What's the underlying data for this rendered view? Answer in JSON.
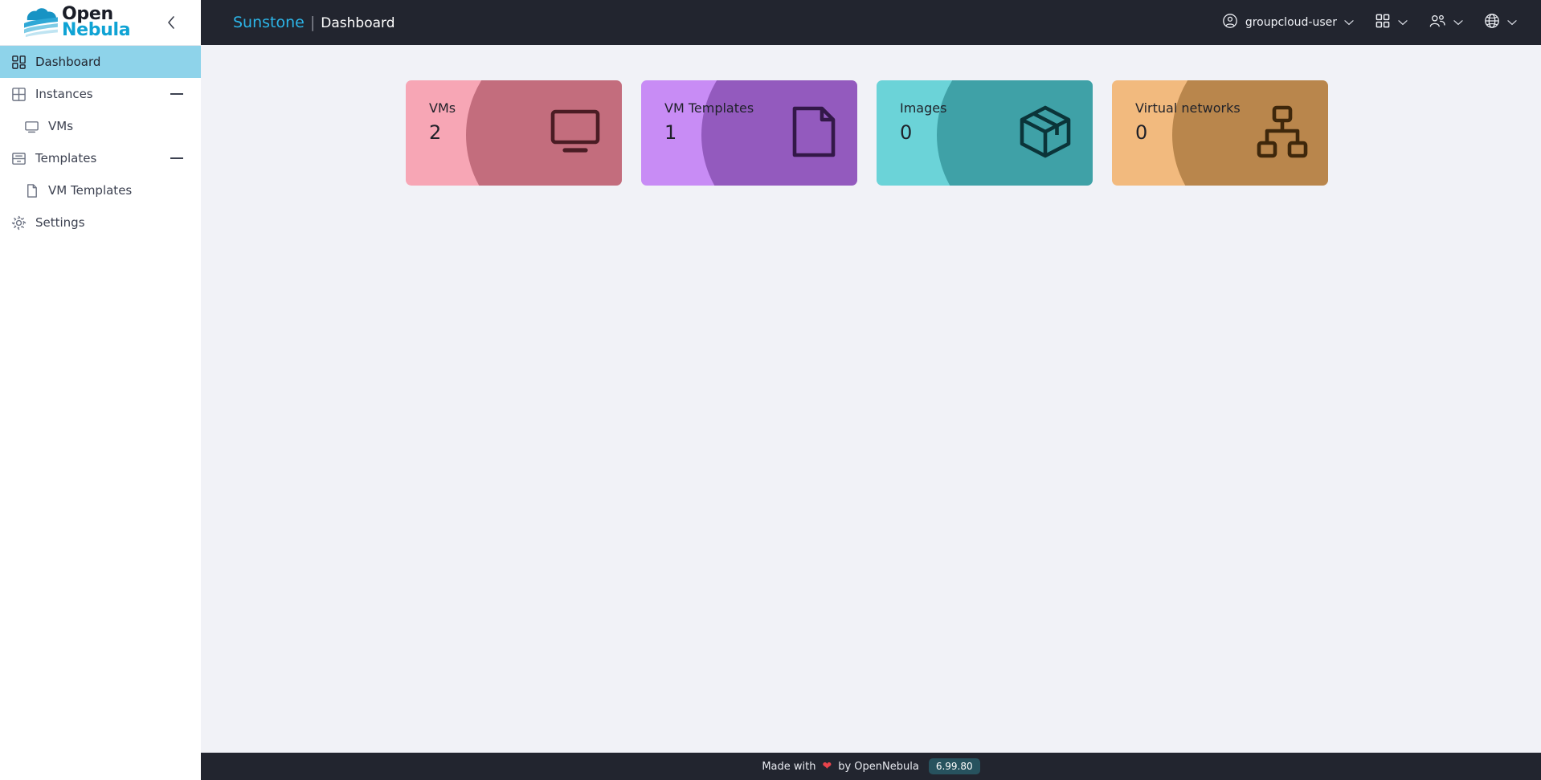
{
  "brand": {
    "logo_line1": "Open",
    "logo_line2": "Nebula",
    "logo_icon": "opennebula-cloud-logo",
    "collapse_icon": "chevron-left-icon"
  },
  "sidebar": {
    "items": [
      {
        "label": "Dashboard",
        "icon": "dashboard-icon",
        "active": true,
        "child": false,
        "expandable": false
      },
      {
        "label": "Instances",
        "icon": "grid-icon",
        "active": false,
        "child": false,
        "expandable": true
      },
      {
        "label": "VMs",
        "icon": "monitor-icon",
        "active": false,
        "child": true,
        "expandable": false
      },
      {
        "label": "Templates",
        "icon": "archive-icon",
        "active": false,
        "child": false,
        "expandable": true
      },
      {
        "label": "VM Templates",
        "icon": "file-icon",
        "active": false,
        "child": true,
        "expandable": false
      },
      {
        "label": "Settings",
        "icon": "gear-icon",
        "active": false,
        "child": false,
        "expandable": false
      }
    ]
  },
  "header": {
    "app_name": "Sunstone",
    "separator": "|",
    "page_title": "Dashboard",
    "user": {
      "label": "groupcloud-user",
      "icon": "user-circle-icon",
      "chevron": "chevron-down-icon"
    },
    "actions": [
      {
        "name": "apps-menu",
        "icon": "apps-grid-icon",
        "chevron": "chevron-down-icon"
      },
      {
        "name": "group-menu",
        "icon": "people-icon",
        "chevron": "chevron-down-icon"
      },
      {
        "name": "zone-menu",
        "icon": "globe-icon",
        "chevron": "chevron-down-icon"
      }
    ]
  },
  "dashboard": {
    "cards": [
      {
        "title": "VMs",
        "value": "2",
        "icon": "monitor-icon",
        "bg": "#F7A6B5",
        "blob": "#7C2030"
      },
      {
        "title": "VM Templates",
        "value": "1",
        "icon": "file-icon",
        "bg": "#C88CF5",
        "blob": "#4B1572"
      },
      {
        "title": "Images",
        "value": "0",
        "icon": "box-icon",
        "bg": "#6BD3D8",
        "blob": "#035C63"
      },
      {
        "title": "Virtual networks",
        "value": "0",
        "icon": "network-icon",
        "bg": "#F2BA7E",
        "blob": "#6B3D06"
      }
    ]
  },
  "footer": {
    "made_with": "Made with",
    "heart": "❤",
    "by": "by OpenNebula",
    "version": "6.99.80"
  },
  "colors": {
    "header_bg": "#22252F",
    "page_bg": "#F1F2F7",
    "accent": "#2CB5E8",
    "active_nav": "#8ED3EA",
    "badge_bg": "#27525E"
  }
}
